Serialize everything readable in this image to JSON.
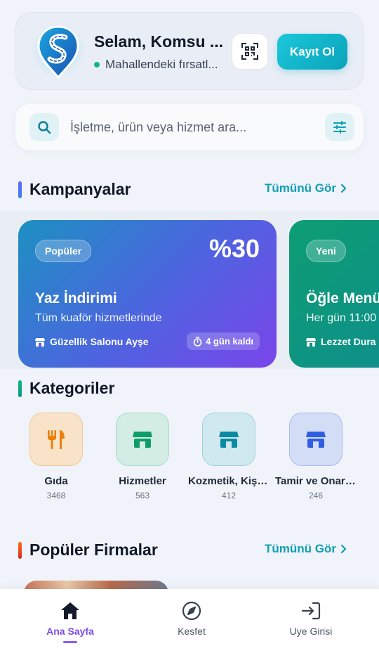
{
  "header": {
    "greeting": "Selam, Komsu ...",
    "subtitle": "Mahallendeki fırsatl...",
    "register_label": "Kayıt Ol",
    "status_color": "#10b981"
  },
  "search": {
    "placeholder": "İşletme, ürün veya hizmet ara..."
  },
  "campaigns_section": {
    "title": "Kampanyalar",
    "see_all": "Tümünü Gör",
    "cards": [
      {
        "badge": "Popüler",
        "discount": "%30",
        "title": "Yaz İndirimi",
        "description": "Tüm kuaför hizmetlerinde",
        "shop": "Güzellik Salonu Ayşe",
        "time_left": "4 gün kaldı"
      },
      {
        "badge": "Yeni",
        "title": "Öğle Menü",
        "description": "Her gün 11:00",
        "shop": "Lezzet Dura"
      }
    ]
  },
  "categories_section": {
    "title": "Kategoriler",
    "items": [
      {
        "name": "Gıda",
        "count": "3468",
        "icon": "utensils-icon"
      },
      {
        "name": "Hizmetler",
        "count": "563",
        "icon": "store-icon"
      },
      {
        "name": "Kozmetik, Kişisel Bakım",
        "count": "412",
        "icon": "store-icon"
      },
      {
        "name": "Tamir ve Onarım",
        "count": "246",
        "icon": "store-icon"
      }
    ]
  },
  "firms_section": {
    "title": "Popüler Firmalar",
    "see_all": "Tümünü Gör"
  },
  "bottom_nav": {
    "items": [
      {
        "label": "Ana Sayfa",
        "icon": "home-icon",
        "active": true
      },
      {
        "label": "Kesfet",
        "icon": "compass-icon",
        "active": false
      },
      {
        "label": "Uye Girisi",
        "icon": "login-icon",
        "active": false
      }
    ]
  },
  "colors": {
    "accent": "#0e9fb6",
    "active_nav": "#7b4be6"
  }
}
